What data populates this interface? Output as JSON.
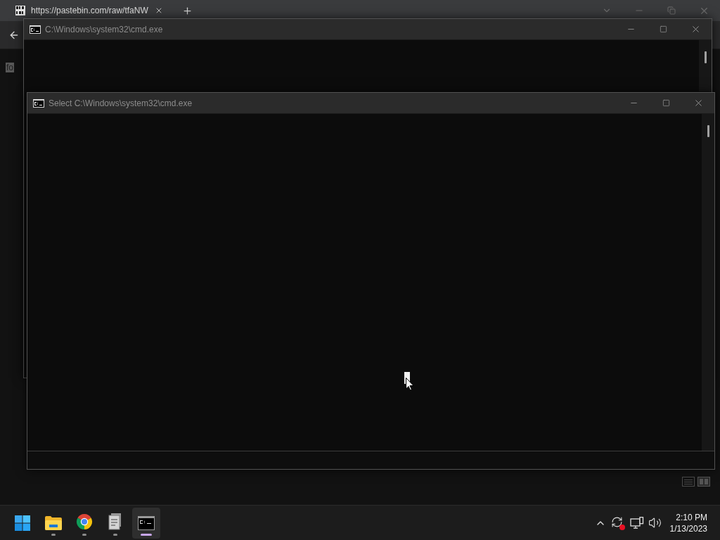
{
  "browser": {
    "tab": {
      "title": "https://pastebin.com/raw/tfaNW"
    },
    "page_text": "fo"
  },
  "windows": [
    {
      "title": "C:\\Windows\\system32\\cmd.exe"
    },
    {
      "title": "Select C:\\Windows\\system32\\cmd.exe"
    }
  ],
  "taskbar": {
    "apps": [
      {
        "kind": "folder",
        "selected": false
      },
      {
        "kind": "browser",
        "selected": false
      },
      {
        "kind": "document",
        "selected": false
      },
      {
        "kind": "terminal",
        "selected": true
      }
    ],
    "clock": {
      "time": "2:10 PM",
      "date": "1/13/2023"
    }
  }
}
